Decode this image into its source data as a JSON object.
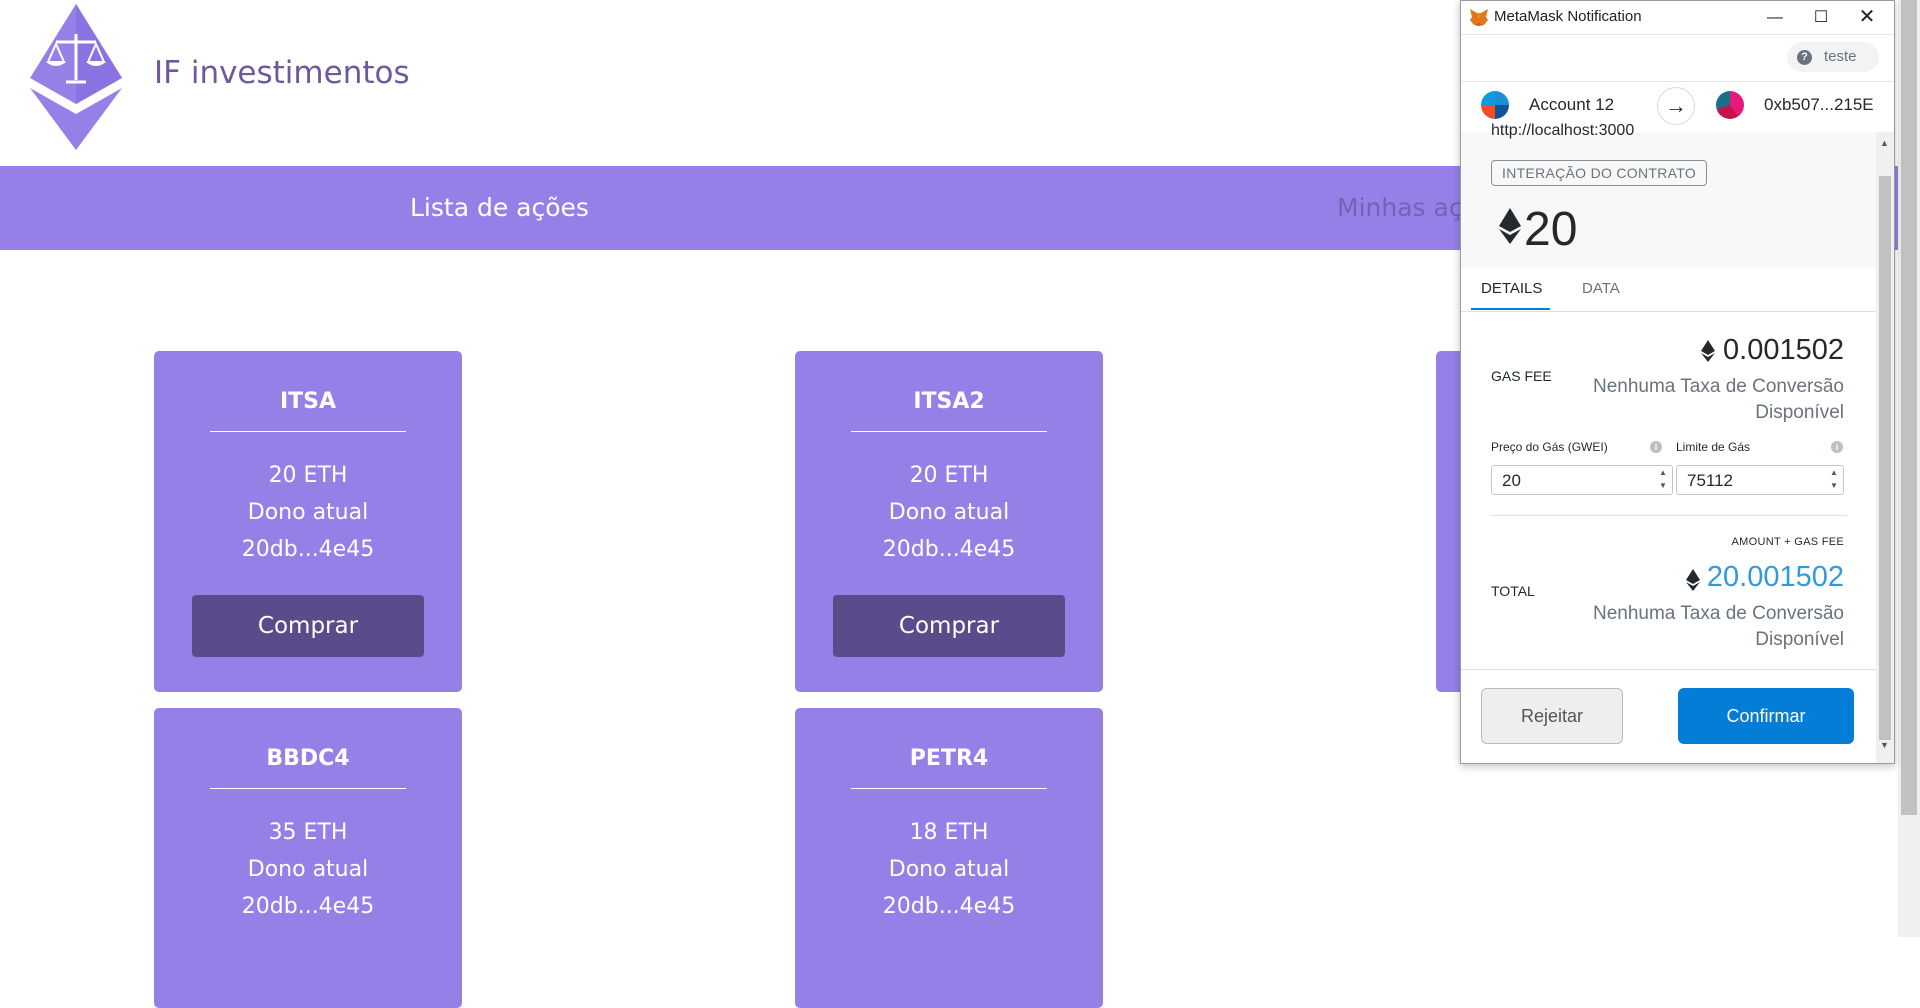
{
  "site": {
    "brand": "IF investimentos",
    "nav": {
      "item1": "Lista de ações",
      "item2": "Minhas açõ"
    }
  },
  "cards": [
    {
      "ticker": "ITSA",
      "price": "20 ETH",
      "owner_label": "Dono atual",
      "owner": "20db...4e45",
      "buy": "Comprar"
    },
    {
      "ticker": "ITSA2",
      "price": "20 ETH",
      "owner_label": "Dono atual",
      "owner": "20db...4e45",
      "buy": "Comprar"
    },
    {
      "ticker": "BBDC4",
      "price": "35 ETH",
      "owner_label": "Dono atual",
      "owner": "20db...4e45"
    },
    {
      "ticker": "PETR4",
      "price": "18 ETH",
      "owner_label": "Dono atual",
      "owner": "20db...4e45"
    }
  ],
  "metamask": {
    "window_title": "MetaMask Notification",
    "controls": {
      "minimize": "—",
      "maximize": "☐",
      "close": "✕"
    },
    "network": {
      "icon": "?",
      "name": "teste"
    },
    "from_account": "Account 12",
    "arrow": "→",
    "to_address": "0xb507...215E",
    "origin": "http://localhost:3000",
    "tx_type": "INTERAÇÃO DO CONTRATO",
    "amount": "20",
    "tabs": {
      "details": "DETAILS",
      "data": "DATA"
    },
    "gas_fee": {
      "label": "GAS FEE",
      "value": "0.001502",
      "conversion": "Nenhuma Taxa de Conversão Disponível"
    },
    "gas_price": {
      "label": "Preço do Gás (GWEI)",
      "value": "20"
    },
    "gas_limit": {
      "label": "Limite de Gás",
      "value": "75112"
    },
    "info_icon": "i",
    "amount_gas_label": "AMOUNT + GAS FEE",
    "total": {
      "label": "TOTAL",
      "value": "20.001502",
      "conversion": "Nenhuma Taxa de Conversão Disponível"
    },
    "buttons": {
      "reject": "Rejeitar",
      "confirm": "Confirmar"
    },
    "colors": {
      "confirm": "#037dd6",
      "total": "#2f9ae0"
    }
  },
  "colors": {
    "brand_purple": "#9680e8",
    "button_dark": "#5c4b8a"
  }
}
